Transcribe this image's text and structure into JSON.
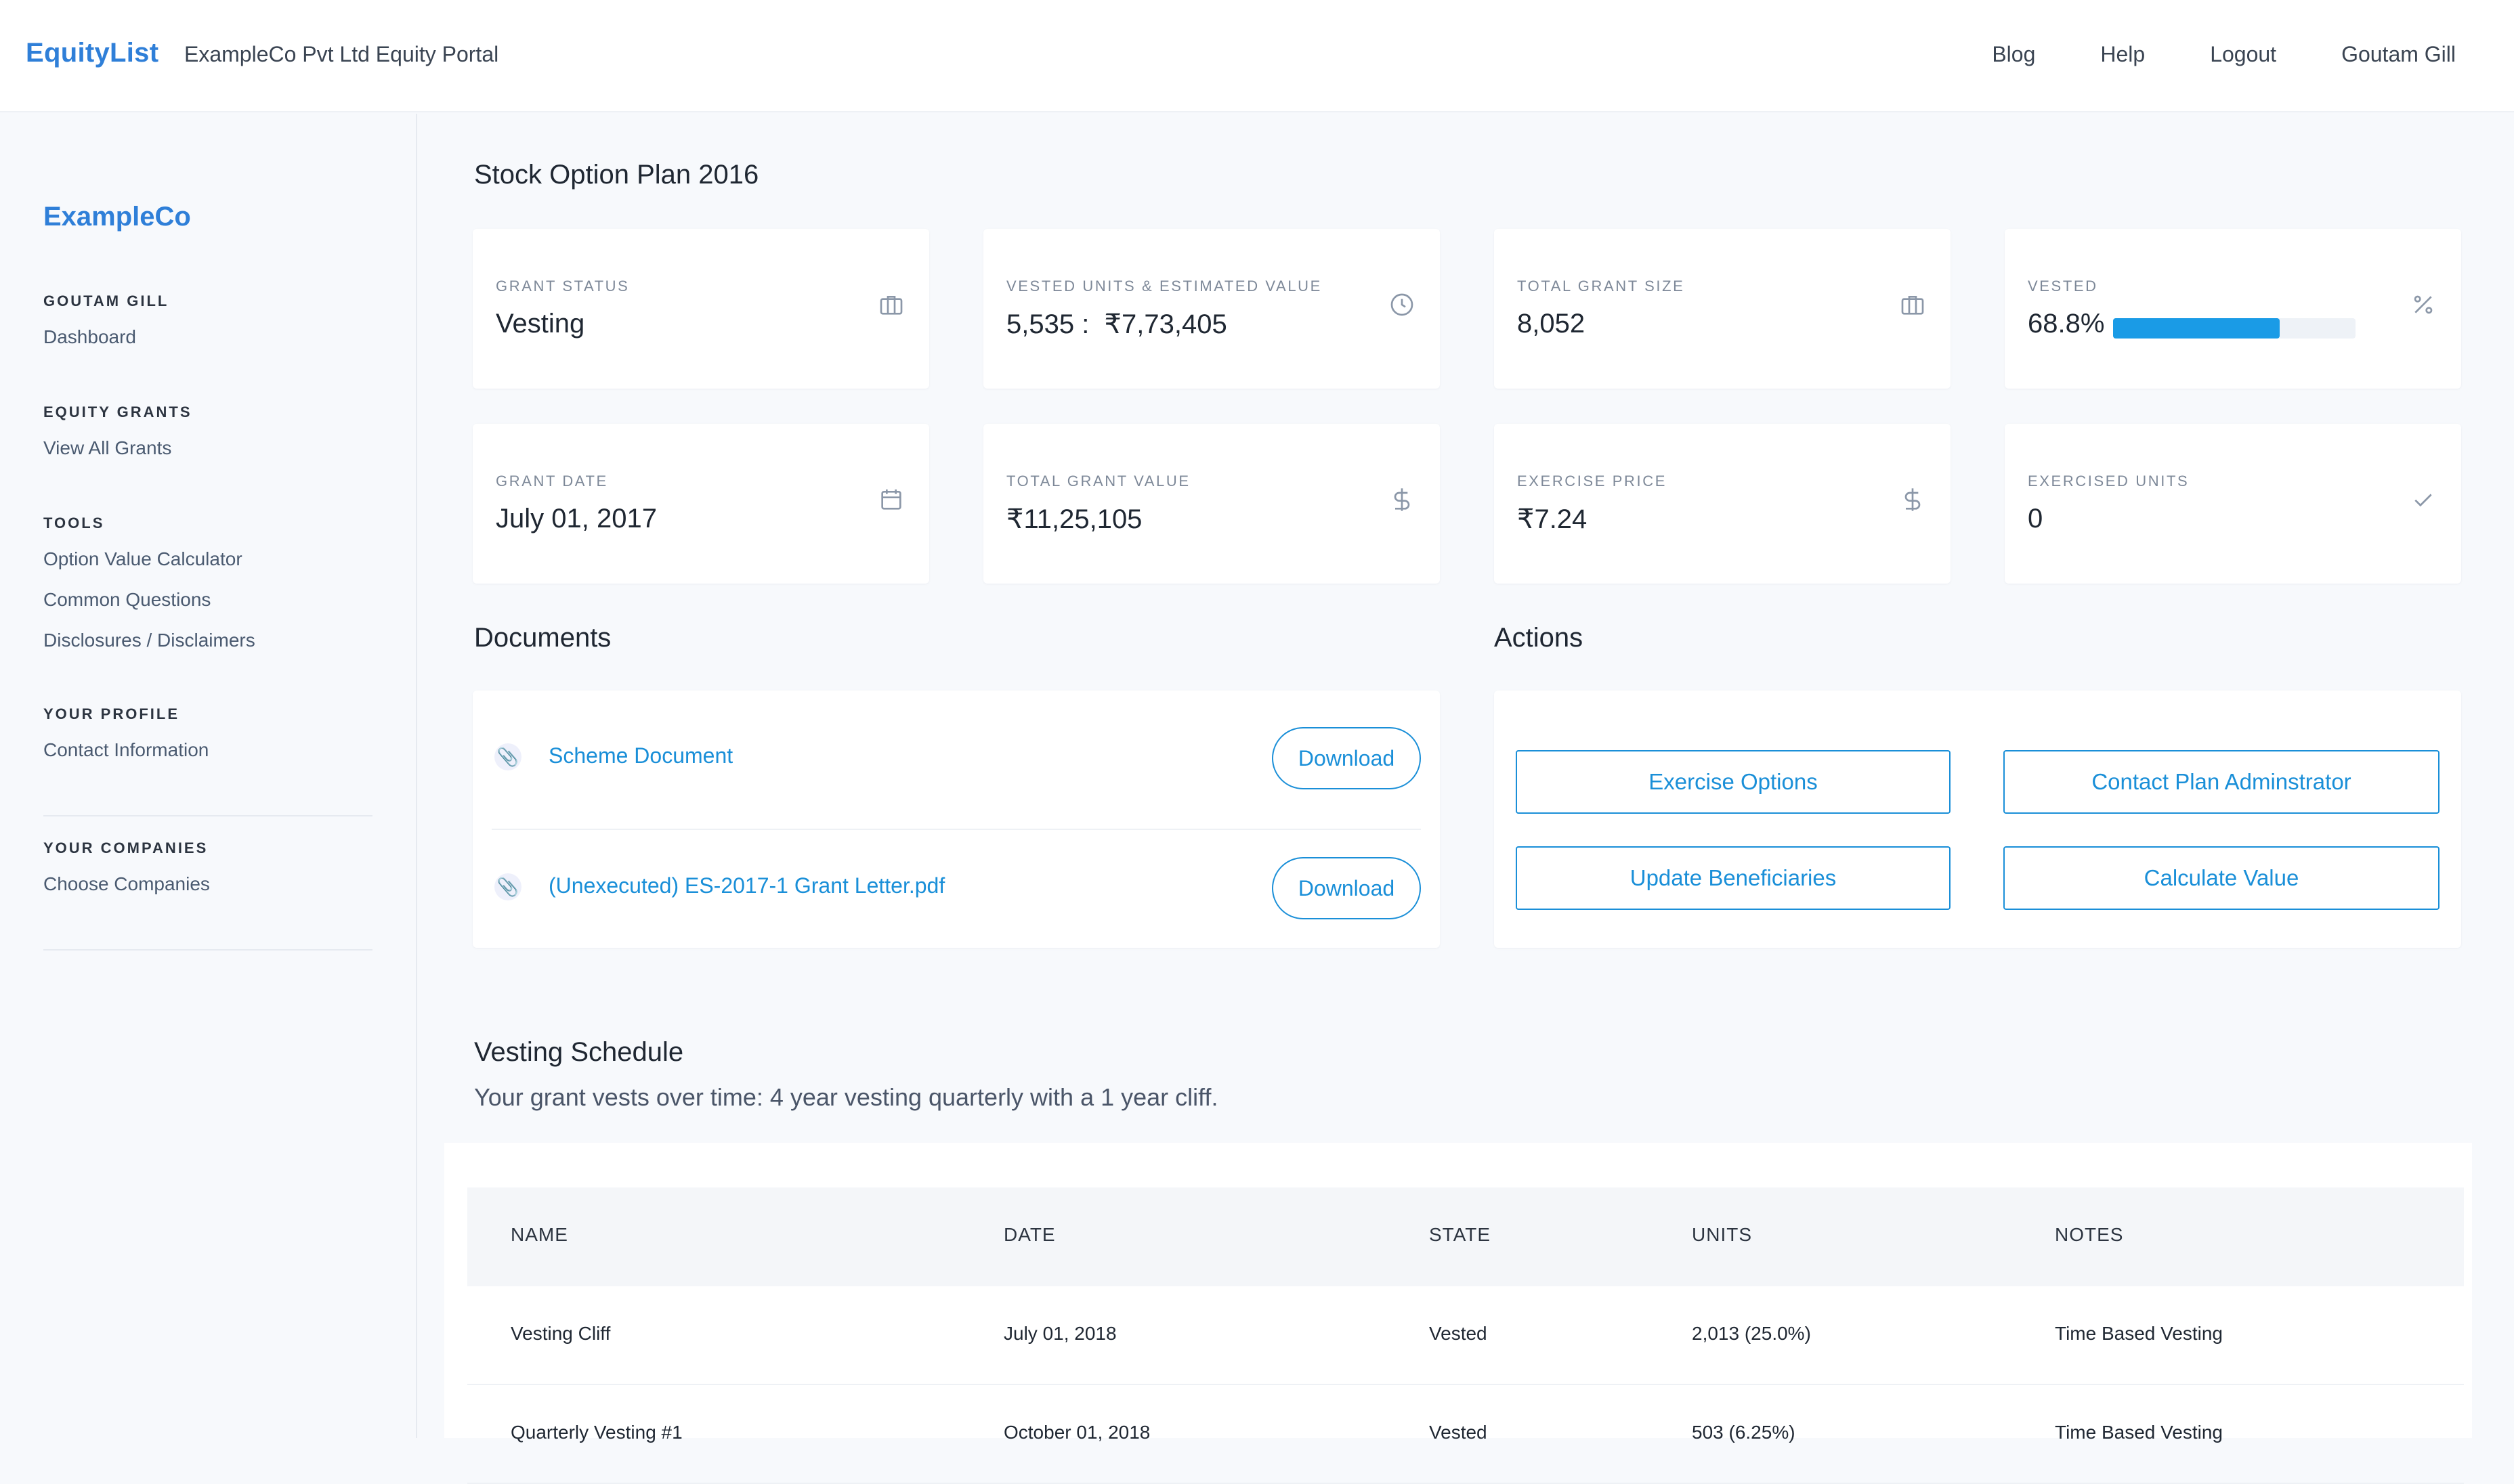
{
  "header": {
    "brand": "EquityList",
    "portal_title": "ExampleCo Pvt Ltd Equity Portal",
    "nav": [
      "Blog",
      "Help",
      "Logout",
      "Goutam Gill"
    ]
  },
  "sidebar": {
    "company": "ExampleCo",
    "sections": [
      {
        "heading": "GOUTAM GILL",
        "links": [
          "Dashboard"
        ]
      },
      {
        "heading": "EQUITY GRANTS",
        "links": [
          "View All Grants"
        ]
      },
      {
        "heading": "TOOLS",
        "links": [
          "Option Value Calculator",
          "Common Questions",
          "Disclosures / Disclaimers"
        ]
      },
      {
        "heading": "YOUR PROFILE",
        "links": [
          "Contact Information"
        ]
      },
      {
        "heading": "YOUR COMPANIES",
        "links": [
          "Choose Companies"
        ]
      }
    ]
  },
  "plan": {
    "title": "Stock Option Plan 2016"
  },
  "stats": [
    {
      "label": "GRANT STATUS",
      "value": "Vesting",
      "icon": "briefcase-icon"
    },
    {
      "label": "VESTED UNITS & ESTIMATED VALUE",
      "value": "5,535 :  ₹7,73,405",
      "icon": "clock-icon"
    },
    {
      "label": "TOTAL GRANT SIZE",
      "value": "8,052",
      "icon": "briefcase-icon"
    },
    {
      "label": "VESTED",
      "value": "68.8%",
      "icon": "percent-icon",
      "progress": 0.688
    },
    {
      "label": "GRANT DATE",
      "value": "July 01, 2017",
      "icon": "calendar-icon"
    },
    {
      "label": "TOTAL GRANT VALUE",
      "value": "₹11,25,105",
      "icon": "dollar-icon"
    },
    {
      "label": "EXERCISE PRICE",
      "value": "₹7.24",
      "icon": "dollar-icon"
    },
    {
      "label": "EXERCISED UNITS",
      "value": "0",
      "icon": "check-icon"
    }
  ],
  "documents": {
    "title": "Documents",
    "items": [
      {
        "name": "Scheme Document",
        "action": "Download"
      },
      {
        "name": "(Unexecuted) ES-2017-1 Grant Letter.pdf",
        "action": "Download"
      }
    ]
  },
  "actions": {
    "title": "Actions",
    "buttons": [
      "Exercise Options",
      "Contact Plan Adminstrator",
      "Update Beneficiaries",
      "Calculate Value"
    ]
  },
  "vesting": {
    "title": "Vesting Schedule",
    "subtitle": "Your grant vests over time: 4 year vesting quarterly with a 1 year cliff.",
    "columns": [
      "NAME",
      "DATE",
      "STATE",
      "UNITS",
      "NOTES"
    ],
    "rows": [
      [
        "Vesting Cliff",
        "July 01, 2018",
        "Vested",
        "2,013 (25.0%)",
        "Time Based Vesting"
      ],
      [
        "Quarterly Vesting #1",
        "October 01, 2018",
        "Vested",
        "503 (6.25%)",
        "Time Based Vesting"
      ]
    ]
  },
  "colors": {
    "accent": "#2f7fd8",
    "link": "#1a8fd8",
    "progress": "#1a9be6"
  }
}
